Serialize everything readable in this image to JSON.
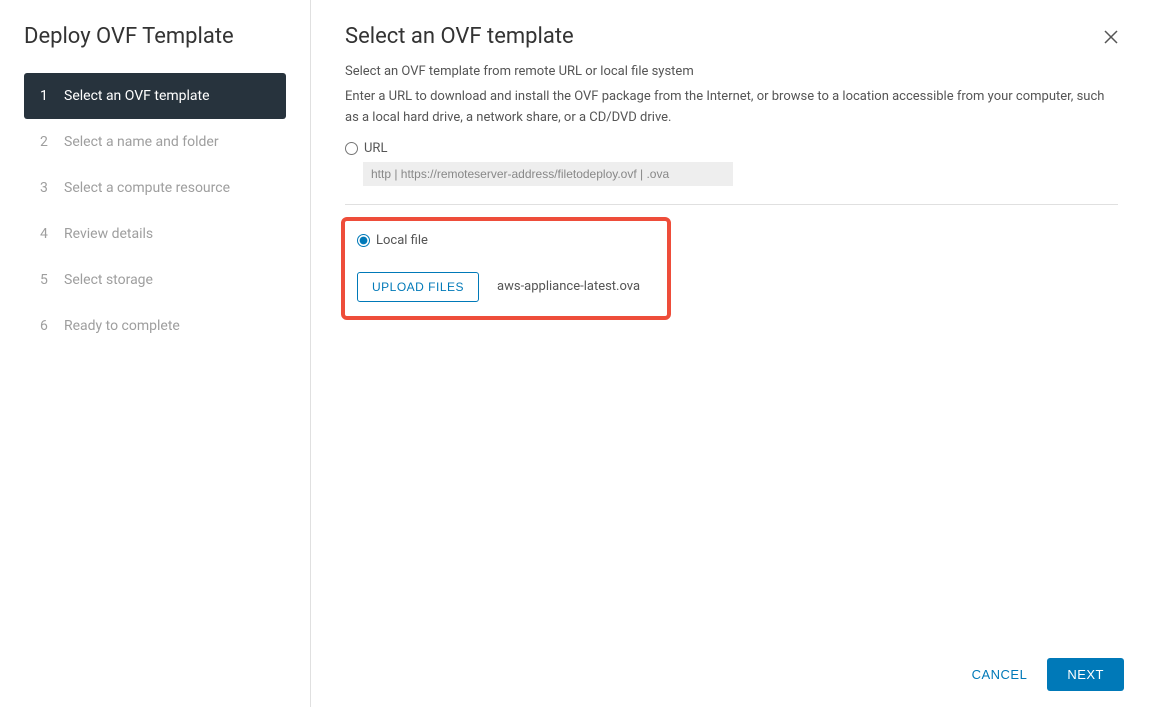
{
  "sidebar": {
    "title": "Deploy OVF Template",
    "steps": [
      {
        "num": "1",
        "label": "Select an OVF template",
        "active": true
      },
      {
        "num": "2",
        "label": "Select a name and folder",
        "active": false
      },
      {
        "num": "3",
        "label": "Select a compute resource",
        "active": false
      },
      {
        "num": "4",
        "label": "Review details",
        "active": false
      },
      {
        "num": "5",
        "label": "Select storage",
        "active": false
      },
      {
        "num": "6",
        "label": "Ready to complete",
        "active": false
      }
    ]
  },
  "main": {
    "title": "Select an OVF template",
    "subtitle": "Select an OVF template from remote URL or local file system",
    "description": "Enter a URL to download and install the OVF package from the Internet, or browse to a location accessible from your computer, such as a local hard drive, a network share, or a CD/DVD drive.",
    "url_label": "URL",
    "url_placeholder": "http | https://remoteserver-address/filetodeploy.ovf | .ova",
    "localfile_label": "Local file",
    "upload_button": "UPLOAD FILES",
    "selected_file": "aws-appliance-latest.ova"
  },
  "footer": {
    "cancel": "CANCEL",
    "next": "NEXT"
  }
}
